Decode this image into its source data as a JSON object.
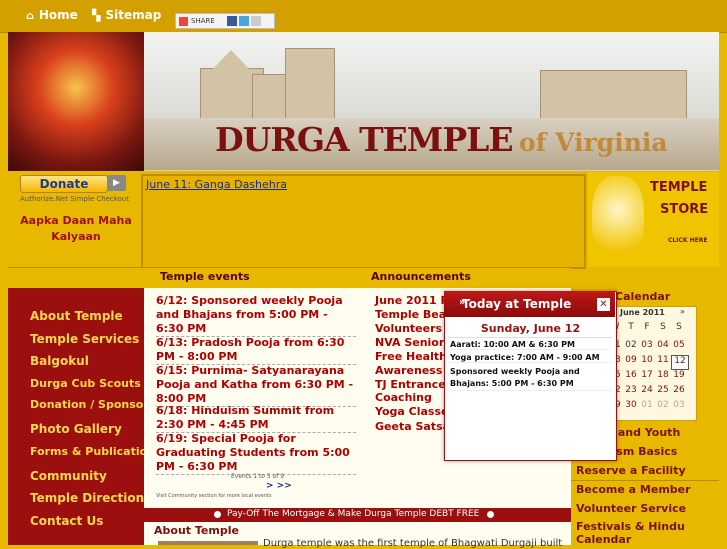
{
  "top_nav": {
    "home": "Home",
    "sitemap": "Sitemap",
    "share": "SHARE"
  },
  "header": {
    "title": "DURGA TEMPLE",
    "subtitle": "of Virginia"
  },
  "donate": {
    "button": "Donate",
    "provider": "Authorize.Net  Simple Checkout",
    "tagline": "Aapka Daan Maha Kalyaan"
  },
  "scroller": {
    "link": "June 11: Ganga Dashehra"
  },
  "store": {
    "line1": "TEMPLE",
    "line2": "STORE",
    "click": "CLICK HERE"
  },
  "sections": {
    "events": "Temple events",
    "announcements": "Announcements",
    "calendar": "Calendar",
    "about": "About Temple"
  },
  "left_nav": [
    "About Temple",
    "Temple Services",
    "Balgokul",
    "Durga Cub Scouts",
    "Donation / Sponsor",
    "Photo Gallery",
    "Forms & Publications",
    "Community",
    "Temple Direction",
    "Contact Us"
  ],
  "events": {
    "items": [
      "6/12: Sponsored weekly Pooja and Bhajans from 5:00 PM - 6:30 PM",
      "6/13: Pradosh Pooja from 6:30 PM - 8:00 PM",
      "6/15: Purnima- Satyanarayana Pooja and Katha from 6:30 PM - 8:00 PM",
      "6/18: Hinduism Summit from 2:30 PM - 4:45 PM",
      "6/19: Special Pooja for Graduating Students from 5:00 PM - 6:30 PM"
    ],
    "count": "Events 1 to 5 of 9",
    "nav": "> >>",
    "note": "Visit Community section for more local events"
  },
  "announcements": [
    "June 2011 R",
    "Temple Bea",
    "Volunteers V",
    "NVA Senior",
    "Free Health",
    "Awareness",
    "TJ Entrance",
    "Coaching",
    "Yoga Classe",
    "Geeta Satsa"
  ],
  "marquee": "Pay-Off The Mortgage & Make Durga Temple DEBT FREE",
  "about_text": "Durga temple was the first temple of Bhagwati Durgaji built",
  "calendar": {
    "month": "June 2011",
    "prev": "«",
    "next": "»",
    "weekdays": [
      "W",
      "T",
      "F",
      "S",
      "S"
    ],
    "rows": [
      [
        "01",
        "02",
        "03",
        "04",
        "05"
      ],
      [
        "08",
        "09",
        "10",
        "11",
        "12"
      ],
      [
        "15",
        "16",
        "17",
        "18",
        "19"
      ],
      [
        "22",
        "23",
        "24",
        "25",
        "26"
      ],
      [
        "29",
        "30",
        "01",
        "02",
        "03"
      ]
    ],
    "today": "12"
  },
  "right_menu": [
    "Young and Youth",
    "Hinduism Basics",
    "Reserve a Facility",
    "Become a Member",
    "Volunteer Service",
    "Festivals & Hindu Calendar"
  ],
  "popup": {
    "title": "Today at Temple",
    "close": "✕",
    "date": "Sunday, June 12",
    "lines": [
      "Aarati: 10:00 AM & 6:30 PM",
      "Yoga practice: 7:00 AM - 9:00 AM",
      "Sponsored weekly Pooja and Bhajans: 5:00 PM - 6:30 PM"
    ]
  },
  "colors": {
    "gold": "#e8b800",
    "maroon": "#9c0f0f",
    "nav_text": "#ffd84a"
  }
}
